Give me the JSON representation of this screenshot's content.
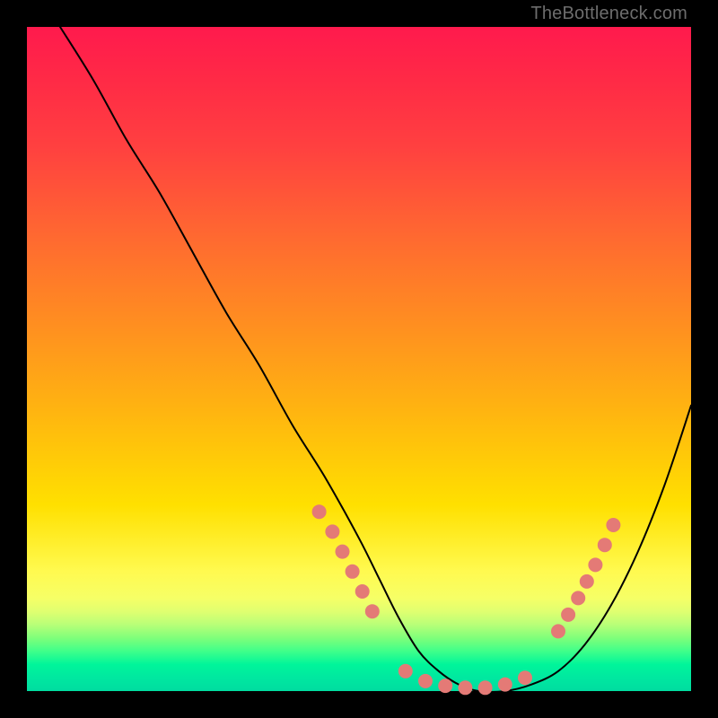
{
  "watermark": "TheBottleneck.com",
  "colors": {
    "dot": "#e47a76",
    "curve": "#000000",
    "frame": "#000000"
  },
  "chart_data": {
    "type": "line",
    "title": "",
    "xlabel": "",
    "ylabel": "",
    "xlim": [
      0,
      100
    ],
    "ylim": [
      0,
      100
    ],
    "grid": false,
    "legend": false,
    "series": [
      {
        "name": "bottleneck-curve",
        "x": [
          5,
          10,
          15,
          20,
          25,
          30,
          35,
          40,
          45,
          50,
          53,
          56,
          59,
          62,
          65,
          68,
          72,
          76,
          80,
          84,
          88,
          92,
          96,
          100
        ],
        "y": [
          100,
          92,
          83,
          75,
          66,
          57,
          49,
          40,
          32,
          23,
          17,
          11,
          6,
          3,
          1,
          0,
          0,
          1,
          3,
          7,
          13,
          21,
          31,
          43
        ]
      }
    ],
    "markers": [
      {
        "x": 44,
        "y": 27
      },
      {
        "x": 46,
        "y": 24
      },
      {
        "x": 47.5,
        "y": 21
      },
      {
        "x": 49,
        "y": 18
      },
      {
        "x": 50.5,
        "y": 15
      },
      {
        "x": 52,
        "y": 12
      },
      {
        "x": 57,
        "y": 3
      },
      {
        "x": 60,
        "y": 1.5
      },
      {
        "x": 63,
        "y": 0.8
      },
      {
        "x": 66,
        "y": 0.5
      },
      {
        "x": 69,
        "y": 0.5
      },
      {
        "x": 72,
        "y": 1
      },
      {
        "x": 75,
        "y": 2
      },
      {
        "x": 80,
        "y": 9
      },
      {
        "x": 81.5,
        "y": 11.5
      },
      {
        "x": 83,
        "y": 14
      },
      {
        "x": 84.3,
        "y": 16.5
      },
      {
        "x": 85.6,
        "y": 19
      },
      {
        "x": 87,
        "y": 22
      },
      {
        "x": 88.3,
        "y": 25
      }
    ]
  }
}
